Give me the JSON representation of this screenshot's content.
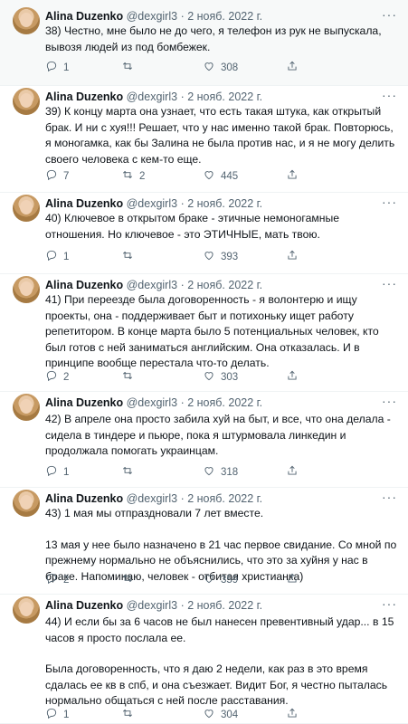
{
  "author": {
    "name": "Alina Duzenko",
    "handle": "@dexgirl3",
    "separator": "·"
  },
  "tweets": [
    {
      "date": "2 нояб. 2022 г.",
      "paras": [
        "38) Честно, мне было не до чего, я телефон из рук не выпускала, вывозя людей из под бомбежек."
      ],
      "replies": "1",
      "retweets": "",
      "likes": "308"
    },
    {
      "date": "2 нояб. 2022 г.",
      "paras": [
        "39) К концу марта она узнает, что есть такая штука, как открытый брак. И ни с хуя!!! Решает, что у нас именно такой брак. Повторюсь, я моногамка, как бы Залина не была против нас, и я не могу делить своего человека с кем-то еще."
      ],
      "replies": "7",
      "retweets": "2",
      "likes": "445"
    },
    {
      "date": "2 нояб. 2022 г.",
      "paras": [
        "40) Ключевое в открытом браке - этичные немоногамные отношения. Но ключевое - это ЭТИЧНЫЕ, мать твою."
      ],
      "replies": "1",
      "retweets": "",
      "likes": "393"
    },
    {
      "date": "2 нояб. 2022 г.",
      "paras": [
        "41) При переезде была договоренность - я волонтерю и ищу проекты, она - поддерживает быт и потихоньку ищет работу репетитором. В конце марта было 5 потенциальных человек, кто был готов с ней заниматься английским. Она отказалась. И в принципе вообще перестала что-то делать."
      ],
      "replies": "2",
      "retweets": "",
      "likes": "303"
    },
    {
      "date": "2 нояб. 2022 г.",
      "paras": [
        "42) В апреле она просто забила хуй на быт, и все, что она делала - сидела в тиндере и пьюре, пока я штурмовала линкедин и продолжала помогать украинцам."
      ],
      "replies": "1",
      "retweets": "",
      "likes": "318"
    },
    {
      "date": "2 нояб. 2022 г.",
      "paras": [
        "43) 1 мая мы отпраздновали 7 лет вместе.",
        "13 мая у нее было назначено в 21 час первое свидание. Со мной по прежнему нормально не объяснились, что это за хуйня у нас в браке. Напоминаю, человек - отбитая христианка)"
      ],
      "replies": "2",
      "retweets": "",
      "likes": "359"
    },
    {
      "date": "2 нояб. 2022 г.",
      "paras": [
        "44) И если бы за 6 часов не был нанесен превентивный удар... в 15 часов я просто послала ее.",
        "Была договоренность, что я даю 2 недели, как раз в это время сдалась ее кв в спб, и она съезжает. Видит Бог, я честно пыталась нормально общаться с ней после расставания."
      ],
      "replies": "1",
      "retweets": "",
      "likes": "304"
    }
  ]
}
